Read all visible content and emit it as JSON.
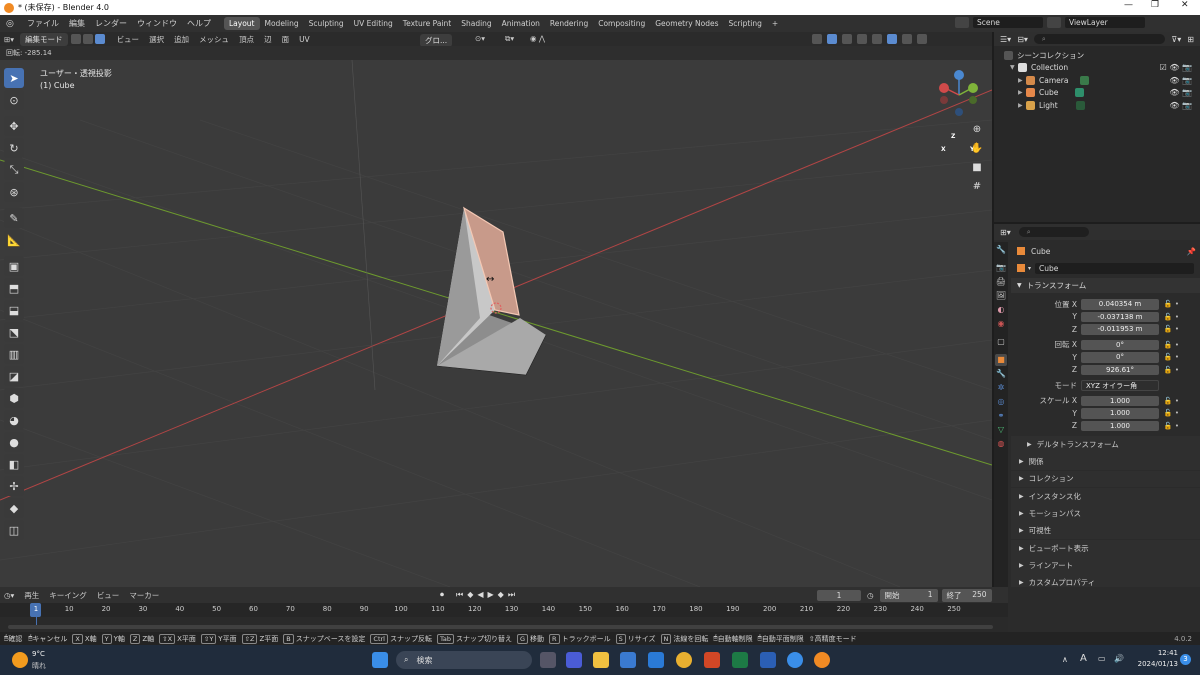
{
  "window": {
    "title": "* (未保存) - Blender 4.0",
    "controls": [
      "—",
      "❐",
      "✕"
    ]
  },
  "menubar": {
    "menus": [
      "ファイル",
      "編集",
      "レンダー",
      "ウィンドウ",
      "ヘルプ"
    ],
    "workspaces": [
      "Layout",
      "Modeling",
      "Sculpting",
      "UV Editing",
      "Texture Paint",
      "Shading",
      "Animation",
      "Rendering",
      "Compositing",
      "Geometry Nodes",
      "Scripting"
    ],
    "active_workspace": "Layout",
    "add_tab": "+",
    "scene": "Scene",
    "viewlayer": "ViewLayer"
  },
  "viewport_header": {
    "mode": "編集モード",
    "menus": [
      "ビュー",
      "選択",
      "追加",
      "メッシュ",
      "頂点",
      "辺",
      "面",
      "UV"
    ],
    "orientation": "グロ..."
  },
  "operator": {
    "text": "回転: -285.14"
  },
  "viewport": {
    "view_name": "ユーザー・透視投影",
    "object_label": "(1) Cube",
    "gizmo": {
      "x": "X",
      "y": "Y",
      "z": "Z"
    }
  },
  "outliner": {
    "root": "シーンコレクション",
    "items": [
      {
        "name": "Collection",
        "icon": "collection-icon"
      },
      {
        "name": "Camera",
        "icon": "camera-icon"
      },
      {
        "name": "Cube",
        "icon": "mesh-icon"
      },
      {
        "name": "Light",
        "icon": "light-icon"
      }
    ]
  },
  "properties": {
    "object_name": "Cube",
    "data_name": "Cube",
    "transform_title": "トランスフォーム",
    "location": {
      "label": "位置 X",
      "x": "0.040354 m",
      "y": "-0.037138 m",
      "z": "-0.011953 m"
    },
    "rotation": {
      "label": "回転 X",
      "x": "0°",
      "y": "0°",
      "z": "926.61°"
    },
    "mode_label": "モード",
    "mode_value": "XYZ オイラー角",
    "scale": {
      "label": "スケール X",
      "x": "1.000",
      "y": "1.000",
      "z": "1.000"
    },
    "axis_y": "Y",
    "axis_z": "Z",
    "delta": "デルタトランスフォーム",
    "sections": [
      "関係",
      "コレクション",
      "インスタンス化",
      "モーションパス",
      "可視性",
      "ビューポート表示",
      "ラインアート",
      "カスタムプロパティ"
    ]
  },
  "timeline": {
    "menus": [
      "再生",
      "キーイング",
      "ビュー",
      "マーカー"
    ],
    "current_frame": "1",
    "start_label": "開始",
    "start": "1",
    "end_label": "終了",
    "end": "250",
    "ticks": [
      "1",
      "10",
      "20",
      "30",
      "40",
      "50",
      "60",
      "70",
      "80",
      "90",
      "100",
      "110",
      "120",
      "130",
      "140",
      "150",
      "160",
      "170",
      "180",
      "190",
      "200",
      "210",
      "220",
      "230",
      "240",
      "250"
    ]
  },
  "statusbar": {
    "items": [
      {
        "key": "",
        "label": "確認"
      },
      {
        "key": "",
        "label": "キャンセル"
      },
      {
        "key": "X",
        "label": "X軸"
      },
      {
        "key": "Y",
        "label": "Y軸"
      },
      {
        "key": "Z",
        "label": "Z軸"
      },
      {
        "key": "⇧X",
        "label": "X平面"
      },
      {
        "key": "⇧Y",
        "label": "Y平面"
      },
      {
        "key": "⇧Z",
        "label": "Z平面"
      },
      {
        "key": "B",
        "label": "スナップベースを設定"
      },
      {
        "key": "Ctrl",
        "label": "スナップ反転"
      },
      {
        "key": "Tab",
        "label": "スナップ切り替え"
      },
      {
        "key": "G",
        "label": "移動"
      },
      {
        "key": "R",
        "label": "トラックボール"
      },
      {
        "key": "S",
        "label": "リサイズ"
      },
      {
        "key": "N",
        "label": "法線を回転"
      },
      {
        "key": "",
        "label": "自動軸制限"
      },
      {
        "key": "",
        "label": "自動平面制限"
      },
      {
        "key": "",
        "label": "高精度モード"
      }
    ],
    "version": "4.0.2"
  },
  "taskbar": {
    "weather_temp": "9°C",
    "weather_desc": "晴れ",
    "search": "検索",
    "ime": "A",
    "time": "12:41",
    "date": "2024/01/13",
    "notifications": "3"
  },
  "colors": {
    "accent": "#4772b3",
    "x_axis": "#d04a4a",
    "y_axis": "#7fb33a",
    "z_axis": "#4a88d0",
    "selected_face": "#e8b9a6"
  }
}
